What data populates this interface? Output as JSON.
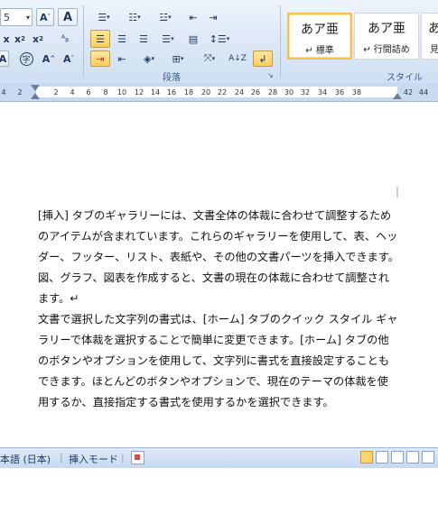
{
  "ribbon": {
    "font_size_value": "5",
    "paragraph_group_label": "段落",
    "style_group_label": "スタイル",
    "styles": [
      {
        "preview": "あア亜",
        "name": "↵ 標準"
      },
      {
        "preview": "あア亜",
        "name": "↵ 行間詰め"
      },
      {
        "preview": "あ",
        "name": "見"
      }
    ]
  },
  "ruler": {
    "numbers": [
      "4",
      "2",
      "2",
      "4",
      "6",
      "8",
      "10",
      "12",
      "14",
      "16",
      "18",
      "20",
      "22",
      "24",
      "26",
      "28",
      "30",
      "32",
      "34",
      "36",
      "38",
      "42",
      "44"
    ]
  },
  "document": {
    "paragraph1": "[挿入] タブのギャラリーには、文書全体の体裁に合わせて調整するためのアイテムが含まれています。これらのギャラリーを使用して、表、ヘッダー、フッター、リスト、表紙や、その他の文書パーツを挿入できます。図、グラフ、図表を作成すると、文書の現在の体裁に合わせて調整されます。↵",
    "paragraph2": "文書で選択した文字列の書式は、[ホーム] タブのクイック スタイル ギャラリーで体裁を選択することで簡単に変更できます。[ホーム] タブの他のボタンやオプションを使用して、文字列に書式を直接設定することもできます。ほとんどのボタンやオプションで、現在のテーマの体裁を使用するか、直接指定する書式を使用するかを選択できます。"
  },
  "status_bar": {
    "language": "本語 (日本)",
    "mode": "挿入モード"
  },
  "colors": {
    "ribbon_bg": "#dbe7f5",
    "active_button": "#ffcf5c",
    "ruler_bg": "#c9daf0"
  }
}
